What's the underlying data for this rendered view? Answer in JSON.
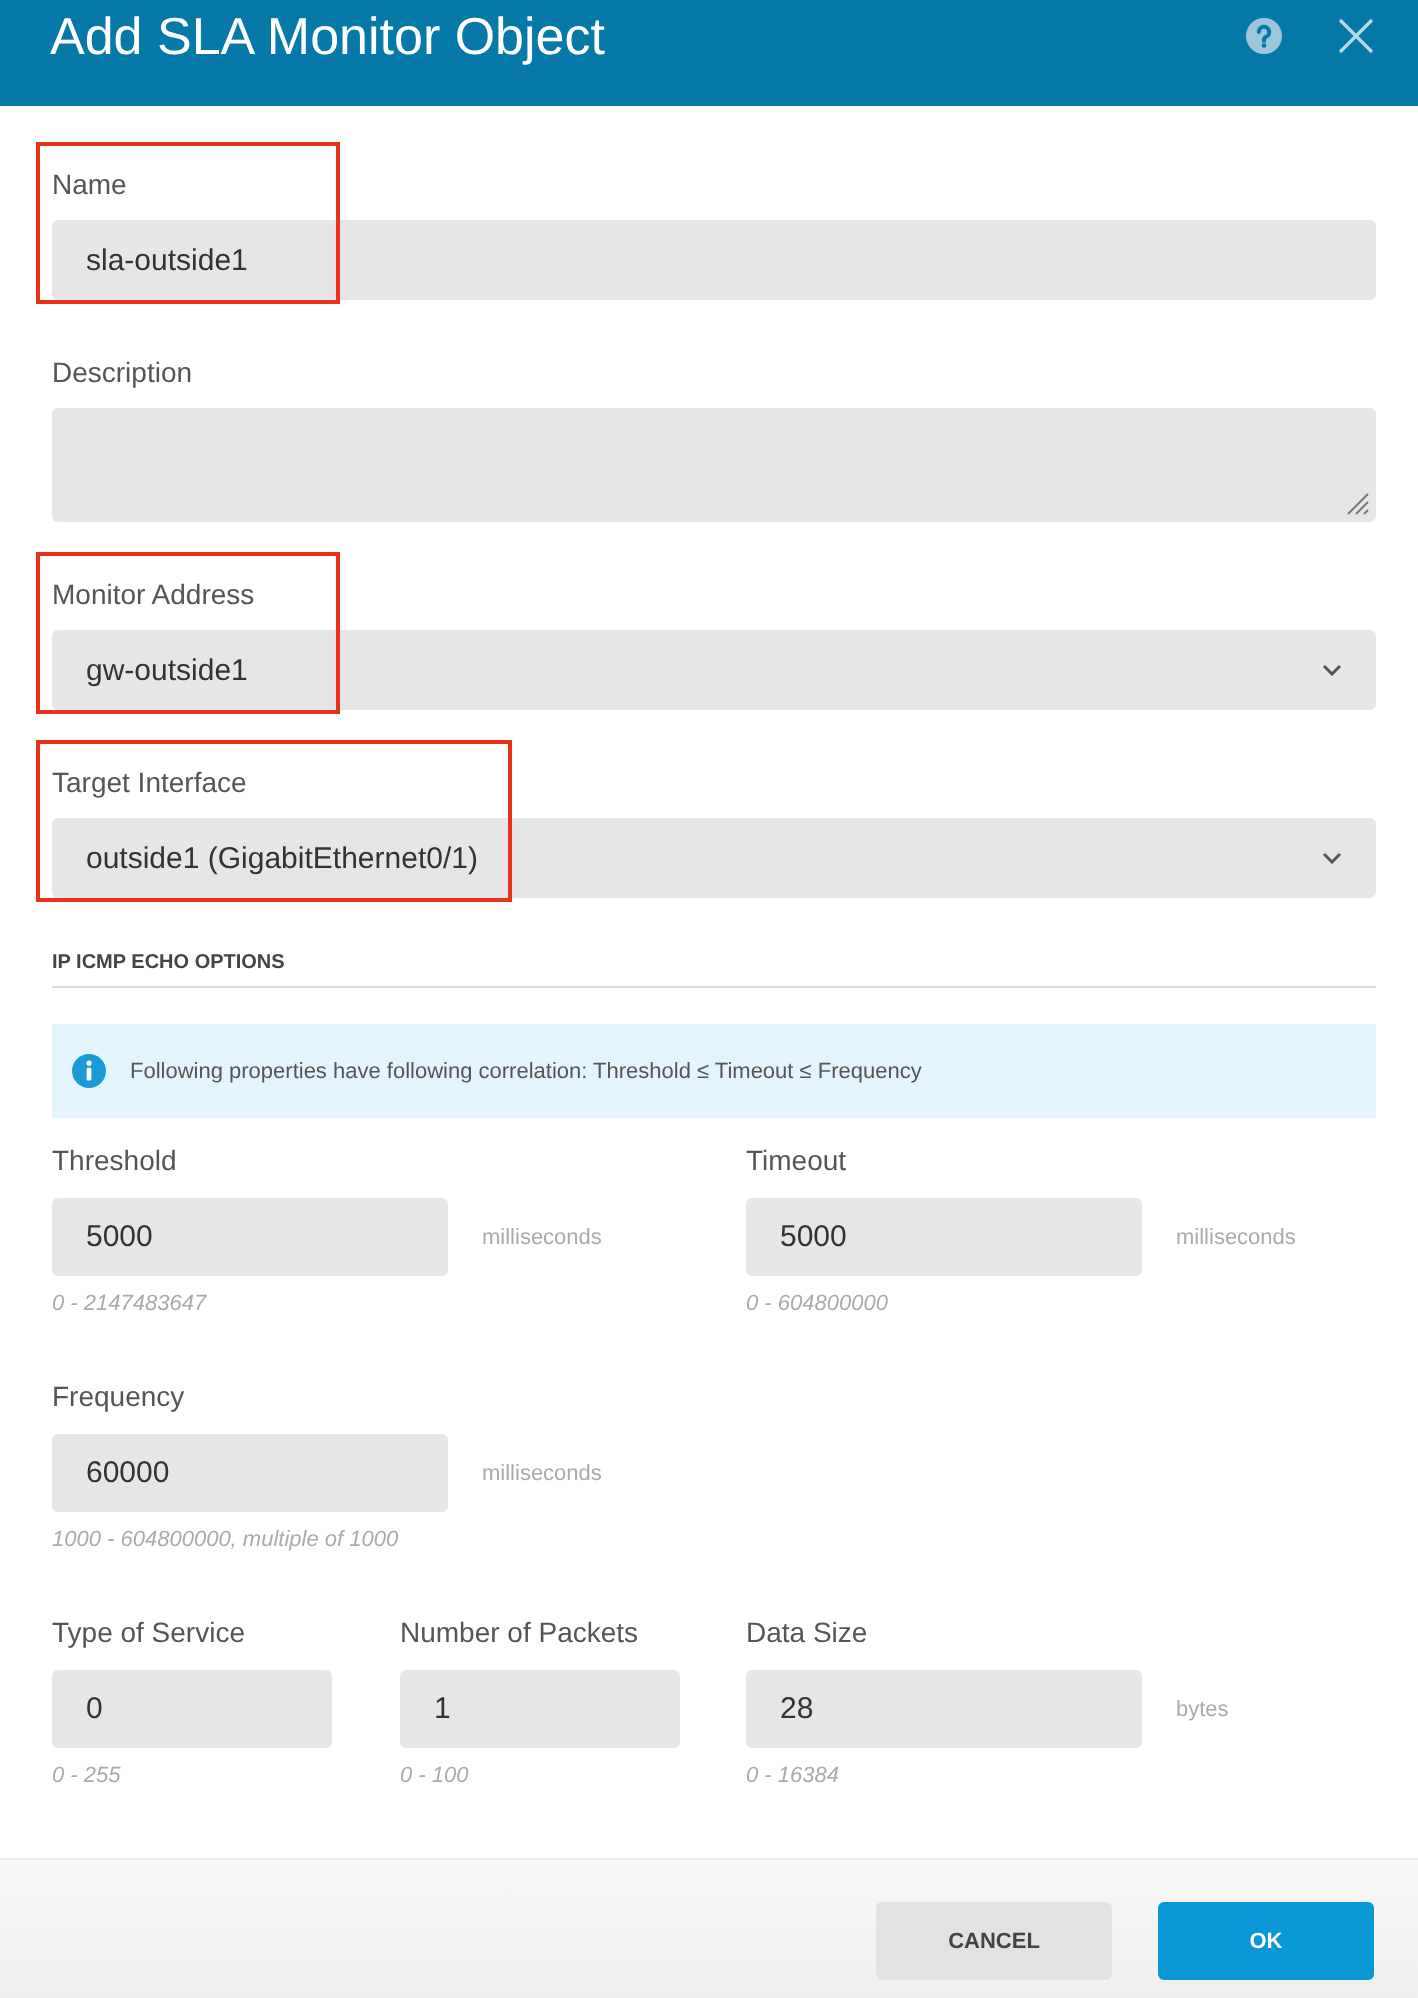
{
  "dialog": {
    "title": "Add SLA Monitor Object"
  },
  "fields": [
    {
      "kind": "text",
      "label": "Name",
      "value": "sla-outside1",
      "highlighted": true
    },
    {
      "kind": "textarea",
      "label": "Description",
      "highlighted": false
    },
    {
      "kind": "select",
      "label": "Monitor Address",
      "value": "gw-outside1",
      "highlighted": true
    },
    {
      "kind": "select",
      "label": "Target Interface",
      "value": "outside1 (GigabitEthernet0/1)",
      "highlighted": true
    }
  ],
  "section": {
    "title": "IP ICMP ECHO OPTIONS",
    "info": "Following properties have following correlation: Threshold ≤ Timeout ≤ Frequency"
  },
  "option_rows": [
    [
      {
        "label": "Threshold",
        "value": "5000",
        "unit": "milliseconds",
        "hint": "0 - 2147483647"
      },
      {
        "label": "Timeout",
        "value": "5000",
        "unit": "milliseconds",
        "hint": "0 - 604800000"
      }
    ],
    [
      {
        "label": "Frequency",
        "value": "60000",
        "unit": "milliseconds",
        "hint": "1000 - 604800000, multiple of 1000"
      }
    ],
    [
      {
        "label": "Type of Service",
        "value": "0",
        "hint": "0 - 255"
      },
      {
        "label": "Number of Packets",
        "value": "1",
        "hint": "0 - 100"
      },
      {
        "label": "Data Size",
        "value": "28",
        "unit": "bytes",
        "hint": "0 - 16384"
      }
    ]
  ],
  "buttons": [
    {
      "label": "CANCEL",
      "kind": "secondary"
    },
    {
      "label": "OK",
      "kind": "primary"
    }
  ]
}
